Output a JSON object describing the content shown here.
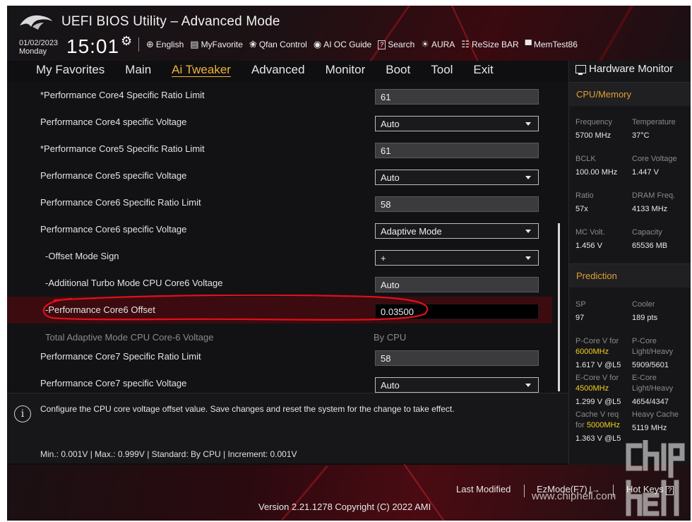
{
  "app": {
    "title": "UEFI BIOS Utility – Advanced Mode",
    "date": "01/02/2023",
    "weekday": "Monday",
    "time": "15:01"
  },
  "toolbar": [
    {
      "icon": "globe-icon",
      "glyph": "⊕",
      "label": "English"
    },
    {
      "icon": "myfavorite-icon",
      "glyph": "▤",
      "label": "MyFavorite"
    },
    {
      "icon": "fan-icon",
      "glyph": "❀",
      "label": "Qfan Control"
    },
    {
      "icon": "ai-oc-icon",
      "glyph": "◉",
      "label": "AI OC Guide"
    },
    {
      "icon": "search-icon",
      "glyph": "?",
      "label": "Search"
    },
    {
      "icon": "aura-icon",
      "glyph": "☀",
      "label": "AURA"
    },
    {
      "icon": "resize-bar-icon",
      "glyph": "☷",
      "label": "ReSize BAR"
    },
    {
      "icon": "memtest-icon",
      "glyph": "▀",
      "label": "MemTest86"
    }
  ],
  "tabs": [
    "My Favorites",
    "Main",
    "Ai Tweaker",
    "Advanced",
    "Monitor",
    "Boot",
    "Tool",
    "Exit"
  ],
  "active_tab": "Ai Tweaker",
  "settings": [
    {
      "label": "*Performance Core4 Specific Ratio Limit",
      "type": "input",
      "value": "61"
    },
    {
      "label": "Performance Core4 specific Voltage",
      "type": "select",
      "value": "Auto"
    },
    {
      "label": "*Performance Core5 Specific Ratio Limit",
      "type": "input",
      "value": "61"
    },
    {
      "label": "Performance Core5 specific Voltage",
      "type": "select",
      "value": "Auto"
    },
    {
      "label": "Performance Core6 Specific Ratio Limit",
      "type": "input",
      "value": "58"
    },
    {
      "label": "Performance Core6 specific Voltage",
      "type": "select",
      "value": "Adaptive Mode"
    },
    {
      "label": "-Offset Mode Sign",
      "type": "select",
      "value": "+"
    },
    {
      "label": "-Additional Turbo Mode CPU Core6 Voltage",
      "type": "input",
      "value": "Auto"
    },
    {
      "label": "-Performance Core6 Offset",
      "type": "input",
      "value": "0.03500"
    },
    {
      "label": "Total Adaptive Mode CPU Core-6 Voltage",
      "type": "readonly",
      "value": "By CPU"
    },
    {
      "label": "Performance Core7 Specific Ratio Limit",
      "type": "input",
      "value": "58"
    },
    {
      "label": "Performance Core7 specific Voltage",
      "type": "select",
      "value": "Auto"
    }
  ],
  "help": {
    "description": "Configure the CPU core voltage offset value. Save changes and reset the system for the change to take effect.",
    "limits": "Min.: 0.001V   |   Max.: 0.999V   |   Standard: By CPU   |   Increment: 0.001V"
  },
  "hardware_monitor": {
    "title": "Hardware Monitor",
    "cpu_memory_section": "CPU/Memory",
    "frequency_label": "Frequency",
    "frequency": "5700 MHz",
    "temperature_label": "Temperature",
    "temperature": "37°C",
    "bclk_label": "BCLK",
    "bclk": "100.00 MHz",
    "core_voltage_label": "Core Voltage",
    "core_voltage": "1.447 V",
    "ratio_label": "Ratio",
    "ratio": "57x",
    "dram_freq_label": "DRAM Freq.",
    "dram_freq": "4133 MHz",
    "mc_volt_label": "MC Volt.",
    "mc_volt": "1.456 V",
    "capacity_label": "Capacity",
    "capacity": "65536 MB",
    "prediction_section": "Prediction",
    "sp_label": "SP",
    "sp": "97",
    "cooler_label": "Cooler",
    "cooler": "189 pts",
    "pcore_v_label": "P-Core V for",
    "pcore_v_freq": "6000MHz",
    "pcore_v": "1.617 V @L5",
    "pcore_lh_label_1": "P-Core",
    "pcore_lh_label_2": "Light/Heavy",
    "pcore_lh": "5909/5601",
    "ecore_v_label": "E-Core V for",
    "ecore_v_freq": "4500MHz",
    "ecore_v": "1.299 V @L5",
    "ecore_lh_label_1": "E-Core",
    "ecore_lh_label_2": "Light/Heavy",
    "ecore_lh": "4654/4347",
    "cache_v_label_1": "Cache V req",
    "cache_v_label_2": "for",
    "cache_v_freq": "5000MHz",
    "cache_v": "1.363 V @L5",
    "heavy_cache_label": "Heavy Cache",
    "heavy_cache": "5119 MHz"
  },
  "footer": {
    "last_modified": "Last Modified",
    "ezmode": "EzMode(F7)",
    "hotkeys": "Hot Keys",
    "version": "Version 2.21.1278 Copyright (C) 2022 AMI"
  },
  "watermark": {
    "url": "www.chiphell.com",
    "logo_text": "chip hell"
  },
  "colors": {
    "accent": "#f0b23a",
    "section_heading": "#e0a030",
    "highlight_freq": "#f0d020",
    "selected_row": "#3c0b10",
    "annotation": "#e0101a"
  }
}
